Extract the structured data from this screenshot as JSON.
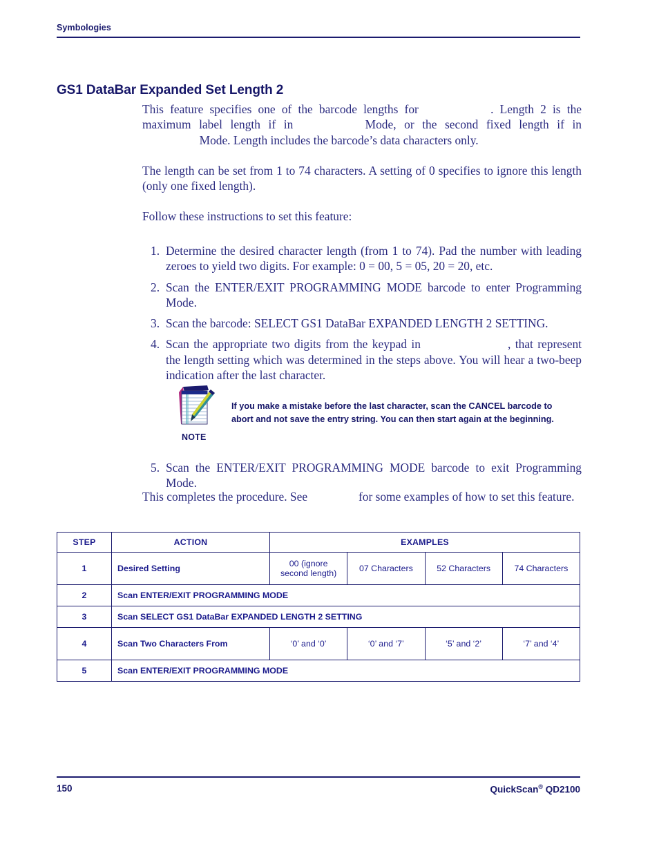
{
  "header": {
    "chapter_title": "Symbologies"
  },
  "section": {
    "heading": "GS1 DataBar Expanded Set Length 2"
  },
  "body": {
    "para1_a": "This feature specifies one of the barcode lengths for",
    "para1_b": ". Length 2 is the maximum label length if in",
    "para1_c": "Mode, or the second fixed length if in",
    "para1_d": "Mode.  Length includes the barcode’s data characters only.",
    "para2": "The length can be set from 1 to 74 characters. A setting of 0 specifies to ignore this length (only one fixed length).",
    "para3": "Follow these instructions to set this feature:"
  },
  "steps": [
    {
      "num": "1.",
      "text": "Determine the desired character length (from 1 to 74). Pad the number with leading zeroes to yield two digits. For example: 0 = 00, 5 = 05, 20 = 20, etc."
    },
    {
      "num": "2.",
      "text": "Scan the ENTER/EXIT PROGRAMMING MODE barcode to enter Programming Mode."
    },
    {
      "num": "3.",
      "text": "Scan the barcode: SELECT GS1 DataBar EXPANDED LENGTH 2 SETTING."
    },
    {
      "num": "4.",
      "text_a": "Scan the appropriate two digits from the keypad in",
      "text_b": ", that represent the length setting which was determined in the steps above. You will hear a two-beep indication after the last character."
    }
  ],
  "note": {
    "label": "NOTE",
    "icon": "notepad-pen-icon",
    "text": "If you make a mistake before the last character, scan the CANCEL barcode to abort and not save the entry string. You can then start again at the beginning."
  },
  "step5": {
    "num": "5.",
    "text": "Scan the ENTER/EXIT PROGRAMMING MODE barcode to exit Programming Mode."
  },
  "closing": {
    "text_a": "This completes the procedure. See",
    "text_b": "for some examples of how to set this feature."
  },
  "table": {
    "headers": {
      "step": "STEP",
      "action": "ACTION",
      "examples": "EXAMPLES"
    },
    "rows": [
      {
        "step": "1",
        "action": "Desired Setting",
        "examples": [
          "00 (ignore second length)",
          "07 Characters",
          "52 Characters",
          "74 Characters"
        ]
      },
      {
        "step": "2",
        "action": "Scan ENTER/EXIT PROGRAMMING MODE",
        "examples": []
      },
      {
        "step": "3",
        "action": "Scan SELECT GS1 DataBar EXPANDED LENGTH 2 SETTING",
        "examples": []
      },
      {
        "step": "4",
        "action": "Scan Two Characters From",
        "examples": [
          "‘0’ and ‘0’",
          "‘0’ and ‘7’",
          "‘5’ and ‘2’",
          "‘7’ and ‘4’"
        ]
      },
      {
        "step": "5",
        "action": "Scan ENTER/EXIT PROGRAMMING MODE",
        "examples": []
      }
    ]
  },
  "footer": {
    "page_number": "150",
    "product_name": "QuickScan",
    "product_mark": "®",
    "product_model": " QD2100"
  },
  "colors": {
    "heading": "#161668",
    "body_text": "#2b2b80",
    "rule": "#1b1b6e",
    "table_border": "#1b1b6e",
    "table_text": "#1b1b8c"
  }
}
